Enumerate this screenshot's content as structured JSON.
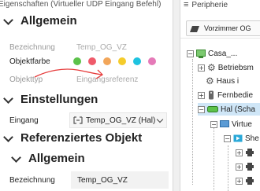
{
  "window_title": "Eigenschaften (Virtueller UDP Eingang Befehl)",
  "sections": {
    "allgemein": "Allgemein",
    "einstellungen": "Einstellungen",
    "referenziertes": "Referenziertes Objekt",
    "ref_allgemein": "Allgemein"
  },
  "properties": {
    "bezeichnung_label": "Bezeichnung",
    "bezeichnung_value": "Temp_OG_VZ",
    "objektfarbe_label": "Objektfarbe",
    "objekttyp_label": "Objekttyp",
    "objekttyp_value": "Eingangsreferenz",
    "eingang_label": "Eingang",
    "eingang_value": "Temp_OG_VZ (Hal)",
    "ref_bezeichnung_label": "Bezeichnung",
    "ref_bezeichnung_value": "Temp_OG_VZ"
  },
  "color_swatches": [
    "#5cc24a",
    "#ef5a6a",
    "#f2a65a",
    "#f5cc2b",
    "#1ec3e0",
    "#e57ab8"
  ],
  "annotation_color": "#e63c3c",
  "right_panel": {
    "title": "Peripherie",
    "toolbar_button": "Vorzimmer OG",
    "tree": {
      "casa": "Casa_...",
      "betriebsm": "Betriebsm",
      "haus": "Haus i",
      "fernbedie": "Fernbedie",
      "hal": "Hal (Scha",
      "virtue": "Virtue",
      "she": "She"
    }
  }
}
